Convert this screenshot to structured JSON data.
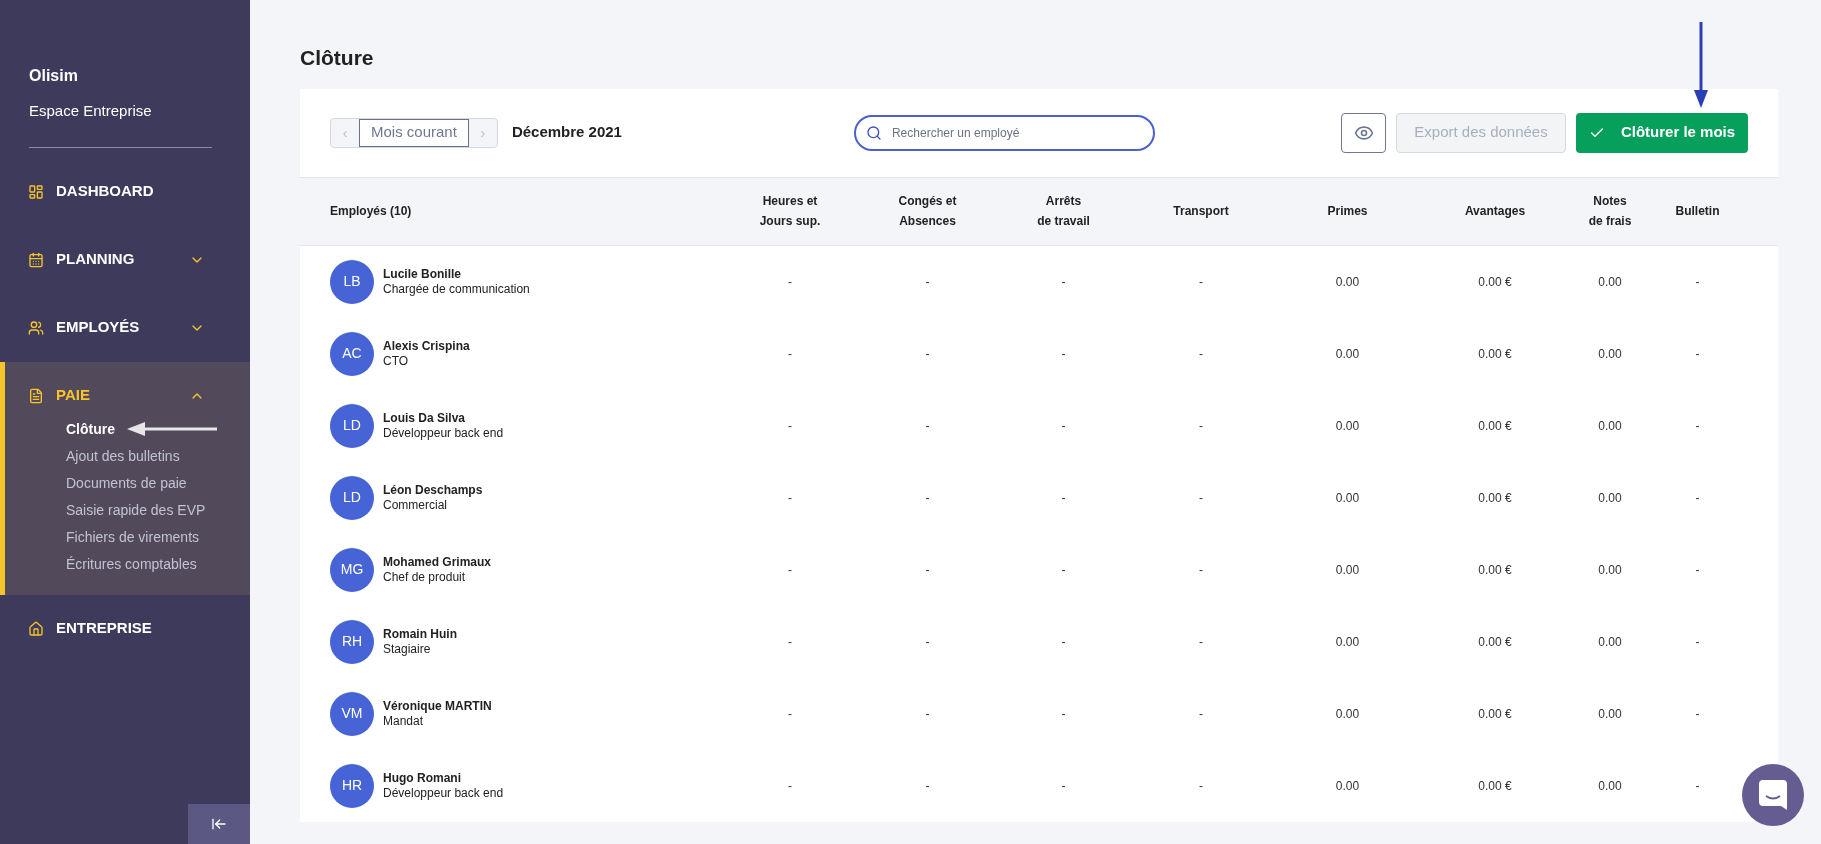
{
  "sidebar": {
    "brand": "Olisim",
    "subtitle": "Espace Entreprise",
    "items": [
      {
        "label": "DASHBOARD",
        "selected": false
      },
      {
        "label": "PLANNING",
        "selected": false,
        "expanded": false
      },
      {
        "label": "EMPLOYÉS",
        "selected": false,
        "expanded": false
      },
      {
        "label": "PAIE",
        "selected": true,
        "expanded": true,
        "children": [
          {
            "label": "Clôture",
            "selected": true
          },
          {
            "label": "Ajout des bulletins",
            "selected": false
          },
          {
            "label": "Documents de paie",
            "selected": false
          },
          {
            "label": "Saisie rapide des EVP",
            "selected": false
          },
          {
            "label": "Fichiers de virements",
            "selected": false
          },
          {
            "label": "Écritures comptables",
            "selected": false
          }
        ]
      },
      {
        "label": "ENTREPRISE",
        "selected": false
      }
    ]
  },
  "page": {
    "title": "Clôture"
  },
  "toolbar": {
    "prev": "‹",
    "period": "Mois courant",
    "next": "›",
    "month": "Décembre 2021",
    "search": {
      "placeholder": "Rechercher un employé"
    },
    "export": {
      "label": "Export des données",
      "disabled": true
    },
    "close": {
      "label": "Clôturer le mois"
    }
  },
  "table": {
    "employee_header": "Employés (10)",
    "columns": [
      "Heures et\nJours sup.",
      "Congés et\nAbsences",
      "Arrêts\nde travail",
      "Transport",
      "Primes",
      "Avantages",
      "Notes\nde frais",
      "Bulletin"
    ],
    "rows": [
      {
        "initials": "LB",
        "name": "Lucile Bonille",
        "role": "Chargée de communication",
        "cells": [
          "-",
          "-",
          "-",
          "-",
          "0.00",
          "0.00 €",
          "0.00",
          "-"
        ]
      },
      {
        "initials": "AC",
        "name": "Alexis Crispina",
        "role": "CTO",
        "cells": [
          "-",
          "-",
          "-",
          "-",
          "0.00",
          "0.00 €",
          "0.00",
          "-"
        ]
      },
      {
        "initials": "LD",
        "name": "Louis Da Silva",
        "role": "Développeur back end",
        "cells": [
          "-",
          "-",
          "-",
          "-",
          "0.00",
          "0.00 €",
          "0.00",
          "-"
        ]
      },
      {
        "initials": "LD",
        "name": "Léon Deschamps",
        "role": "Commercial",
        "cells": [
          "-",
          "-",
          "-",
          "-",
          "0.00",
          "0.00 €",
          "0.00",
          "-"
        ]
      },
      {
        "initials": "MG",
        "name": "Mohamed Grimaux",
        "role": "Chef de produit",
        "cells": [
          "-",
          "-",
          "-",
          "-",
          "0.00",
          "0.00 €",
          "0.00",
          "-"
        ]
      },
      {
        "initials": "RH",
        "name": "Romain Huin",
        "role": "Stagiaire",
        "cells": [
          "-",
          "-",
          "-",
          "-",
          "0.00",
          "0.00 €",
          "0.00",
          "-"
        ]
      },
      {
        "initials": "VM",
        "name": "Véronique MARTIN",
        "role": "Mandat",
        "cells": [
          "-",
          "-",
          "-",
          "-",
          "0.00",
          "0.00 €",
          "0.00",
          "-"
        ]
      },
      {
        "initials": "HR",
        "name": "Hugo Romani",
        "role": "Développeur back end",
        "cells": [
          "-",
          "-",
          "-",
          "-",
          "0.00",
          "0.00 €",
          "0.00",
          "-"
        ]
      }
    ]
  }
}
